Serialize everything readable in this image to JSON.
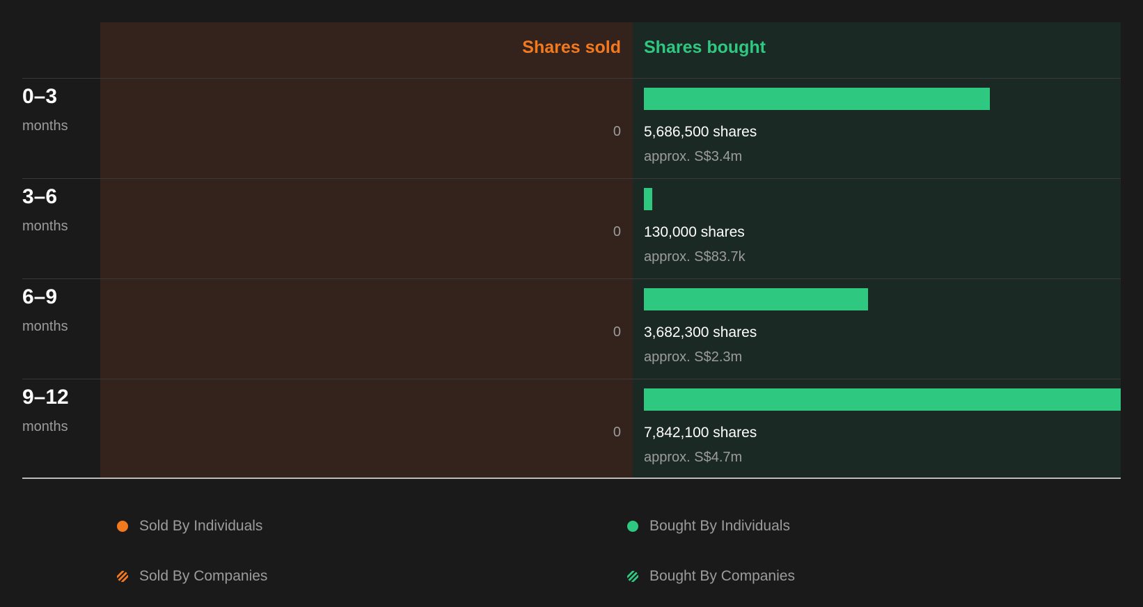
{
  "chart_data": {
    "type": "bar",
    "title": "",
    "xlabel": "",
    "ylabel": "",
    "column_headers": {
      "sold": "Shares sold",
      "bought": "Shares bought"
    },
    "period_unit": "months",
    "categories": [
      "0–3",
      "3–6",
      "6–9",
      "9–12"
    ],
    "series": [
      {
        "name": "Shares sold",
        "values": [
          0,
          0,
          0,
          0
        ],
        "value_labels": [
          "0",
          "0",
          "0",
          "0"
        ]
      },
      {
        "name": "Shares bought",
        "values": [
          5686500,
          130000,
          3682300,
          7842100
        ],
        "value_labels": [
          "5,686,500 shares",
          "130,000 shares",
          "3,682,300 shares",
          "7,842,100 shares"
        ],
        "approx_labels": [
          "approx. S$3.4m",
          "approx. S$83.7k",
          "approx. S$2.3m",
          "approx. S$4.7m"
        ]
      }
    ],
    "xlim": [
      0,
      7842100
    ],
    "grid": false,
    "legend_position": "bottom",
    "legend": [
      {
        "label": "Sold By Individuals",
        "color": "#f3791f",
        "pattern": "solid"
      },
      {
        "label": "Bought By Individuals",
        "color": "#2fc880",
        "pattern": "solid"
      },
      {
        "label": "Sold By Companies",
        "color": "#f3791f",
        "pattern": "striped"
      },
      {
        "label": "Bought By Companies",
        "color": "#2fc880",
        "pattern": "striped"
      }
    ],
    "colors": {
      "sold": "#f3791f",
      "bought": "#2fc880",
      "sold_bg": "#33231c",
      "bought_bg": "#1b2924",
      "page_bg": "#1a1a1a"
    }
  }
}
